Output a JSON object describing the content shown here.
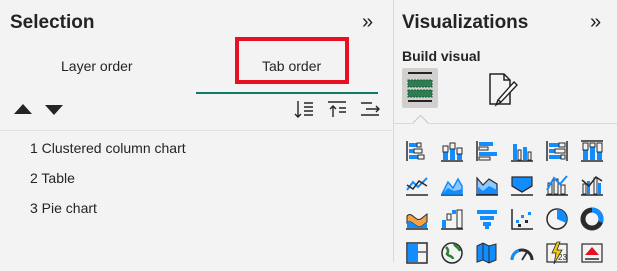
{
  "selection": {
    "title": "Selection",
    "collapse_icon": "chevron-double-right-icon",
    "tabs": [
      {
        "label": "Layer order",
        "selected": false
      },
      {
        "label": "Tab order",
        "selected": true
      }
    ],
    "tools": {
      "move_up_icon": "triangle-up-icon",
      "move_down_icon": "triangle-down-icon",
      "sort_icon": "sort-icon",
      "bring_front_icon": "bring-to-front-icon",
      "show_hide_icon": "show-hide-icon"
    },
    "items": [
      {
        "label": "1 Clustered column chart"
      },
      {
        "label": "2 Table"
      },
      {
        "label": "3 Pie chart"
      }
    ],
    "accent_color": "#117865",
    "highlight_color": "#e81123"
  },
  "visualizations": {
    "title": "Visualizations",
    "collapse_icon": "chevron-double-right-icon",
    "build_visual_label": "Build visual",
    "build_visual_icon": "build-visual-icon",
    "format_visual_icon": "format-visual-icon",
    "gallery": [
      "stacked-bar-chart-icon",
      "stacked-column-chart-icon",
      "clustered-bar-chart-icon",
      "clustered-column-chart-icon",
      "100-stacked-bar-chart-icon",
      "100-stacked-column-chart-icon",
      "line-chart-icon",
      "area-chart-icon",
      "stacked-area-chart-icon",
      "ribbon-chart-icon",
      "line-and-column-chart-icon",
      "line-and-clustered-column-chart-icon",
      "ribbon-alt-chart-icon",
      "waterfall-chart-icon",
      "funnel-chart-icon",
      "scatter-chart-icon",
      "pie-chart-icon",
      "donut-chart-icon",
      "treemap-icon",
      "map-icon",
      "filled-map-icon",
      "gauge-icon",
      "card-icon",
      "kpi-icon"
    ]
  }
}
